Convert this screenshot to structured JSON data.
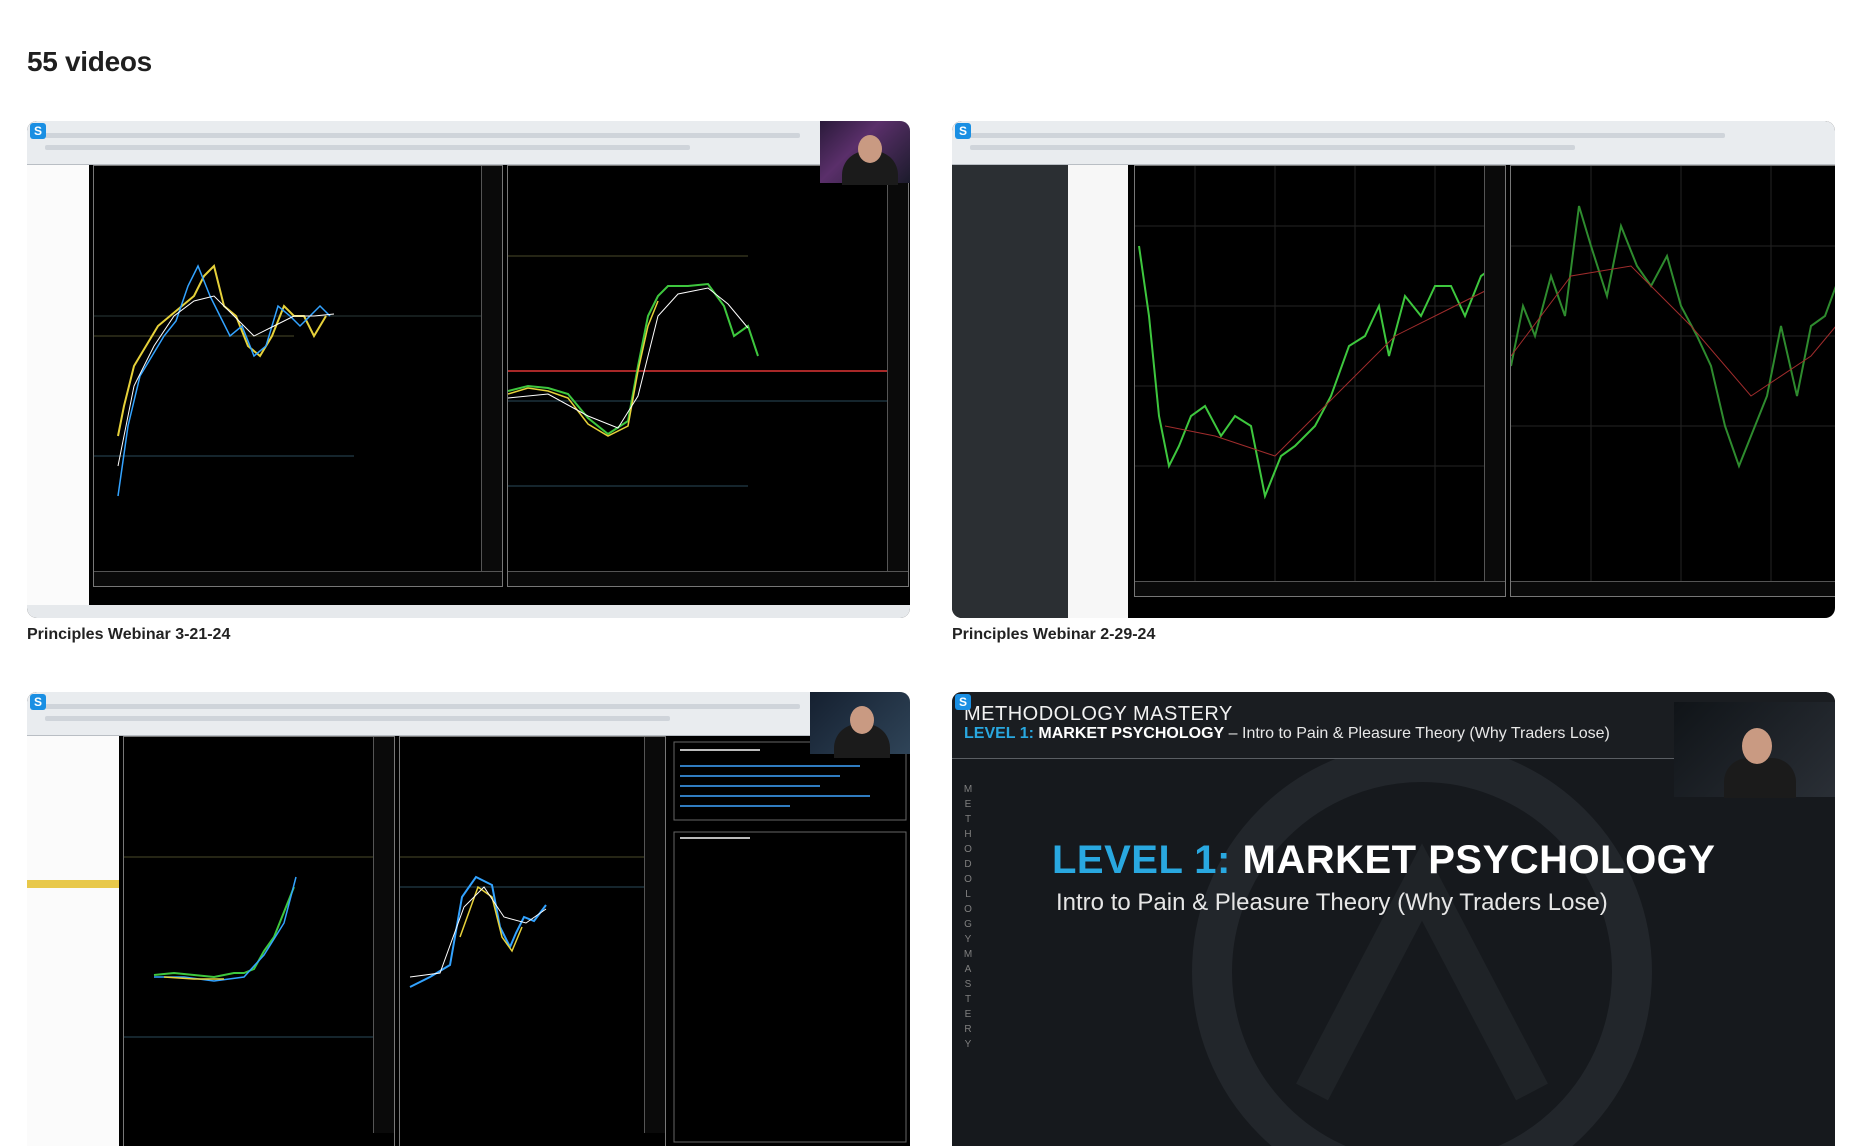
{
  "header": {
    "video_count": "55 videos"
  },
  "videos": [
    {
      "title": "Principles Webinar 3-21-24"
    },
    {
      "title": "Principles Webinar 2-29-24"
    },
    {
      "title": ""
    },
    {
      "title": ""
    }
  ],
  "slide": {
    "series": "METHODOLOGY MASTERY",
    "level": "LEVEL 1:",
    "topic": "MARKET PSYCHOLOGY",
    "dash": " – ",
    "subtitle": "Intro to Pain & Pleasure Theory (Why Traders Lose)",
    "vertical": "METHODOLOGY MASTERY"
  },
  "icons": {
    "badge": "streamyard-s-icon"
  },
  "colors": {
    "accent": "#29a8e0",
    "candle_green": "#3ec73e",
    "candle_yellow": "#e6d13a"
  }
}
